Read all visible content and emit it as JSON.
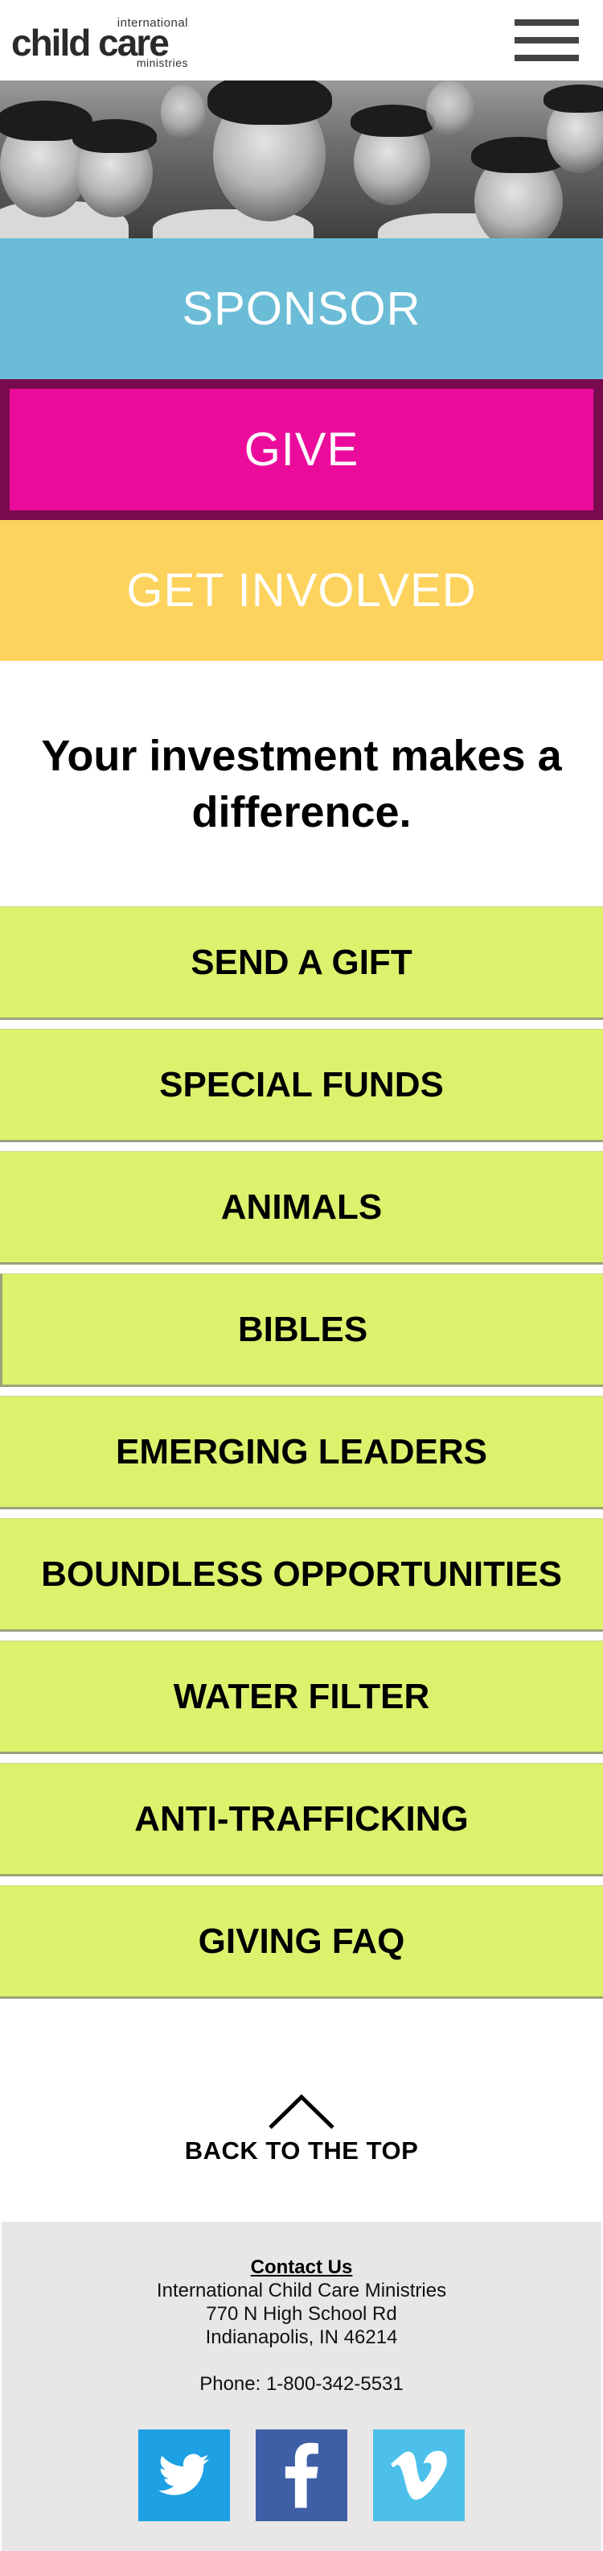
{
  "header": {
    "logo_top": "international",
    "logo_main": "child care",
    "logo_bottom": "ministries",
    "menu_icon": "hamburger-menu-icon"
  },
  "hero": {
    "image": "photo of smiling children making peace signs (grayscale)"
  },
  "primary_actions": {
    "sponsor_label": "SPONSOR",
    "give_label": "GIVE",
    "get_involved_label": "GET INVOLVED",
    "colors": {
      "sponsor": "#6bbcd6",
      "give": "#ec0c9c",
      "give_border": "#7a0a4e",
      "get_involved": "#fdd35d"
    }
  },
  "headline": {
    "text": "Your investment makes a difference."
  },
  "gift_options": {
    "color": "#dbf26d",
    "items": [
      {
        "label": "SEND A GIFT"
      },
      {
        "label": "SPECIAL FUNDS"
      },
      {
        "label": "ANIMALS"
      },
      {
        "label": "BIBLES"
      },
      {
        "label": "EMERGING LEADERS"
      },
      {
        "label": "BOUNDLESS OPPORTUNITIES"
      },
      {
        "label": "WATER FILTER"
      },
      {
        "label": "ANTI-TRAFFICKING"
      },
      {
        "label": "GIVING FAQ"
      }
    ]
  },
  "back_to_top": {
    "label": "BACK TO THE TOP",
    "icon": "chevron-up-icon"
  },
  "footer": {
    "contact_heading": "Contact Us",
    "org_name": "International Child Care Ministries",
    "address_line1": "770 N High School Rd",
    "address_line2": "Indianapolis, IN 46214",
    "phone": "Phone: 1-800-342-5531",
    "social": [
      {
        "name": "twitter",
        "icon": "twitter-icon",
        "color": "#1ea0e4"
      },
      {
        "name": "facebook",
        "icon": "facebook-icon",
        "color": "#3e5fa6"
      },
      {
        "name": "vimeo",
        "icon": "vimeo-icon",
        "color": "#4cc0ea"
      }
    ]
  }
}
